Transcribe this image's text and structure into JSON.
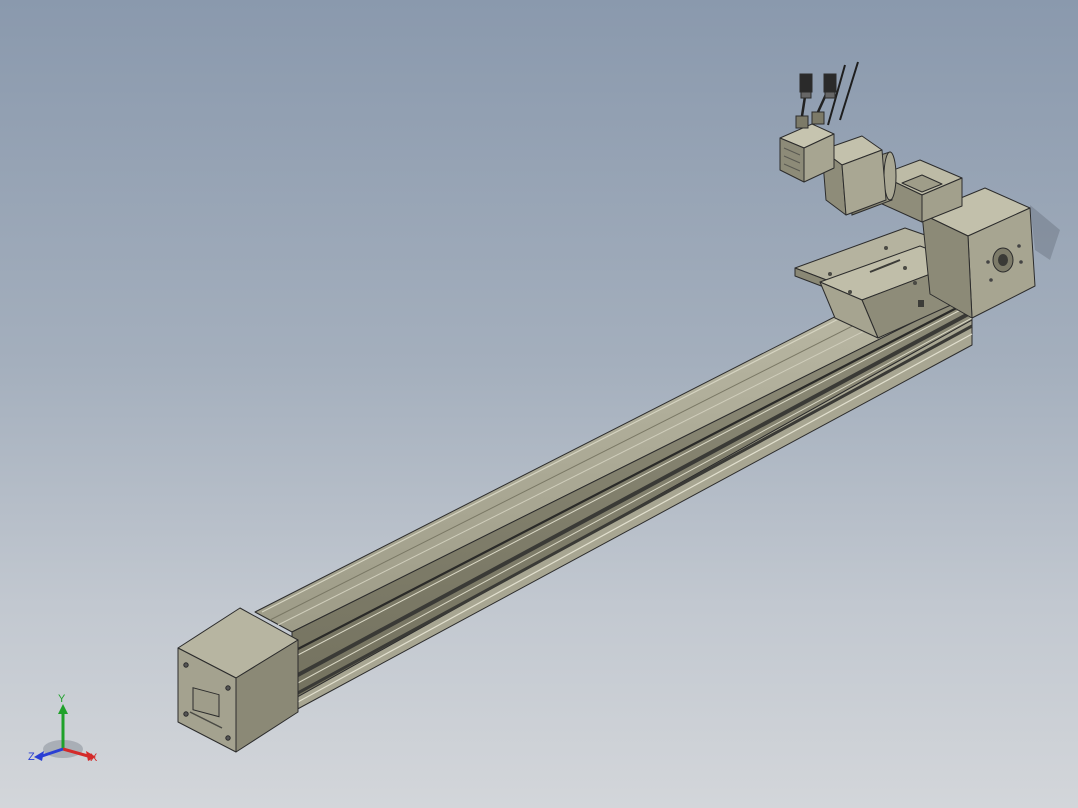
{
  "viewport": {
    "background_top": "#8a99ad",
    "background_bottom": "#d3d6da"
  },
  "part_colors": {
    "body": "#9a9885",
    "body_light": "#b4b29e",
    "body_dark": "#6f6d5e",
    "edge": "#2c2c2c"
  },
  "triad": {
    "x_label": "X",
    "y_label": "Y",
    "z_label": "Z",
    "x_color": "#d42a2a",
    "y_color": "#1fa12a",
    "z_color": "#2a3fd4"
  }
}
